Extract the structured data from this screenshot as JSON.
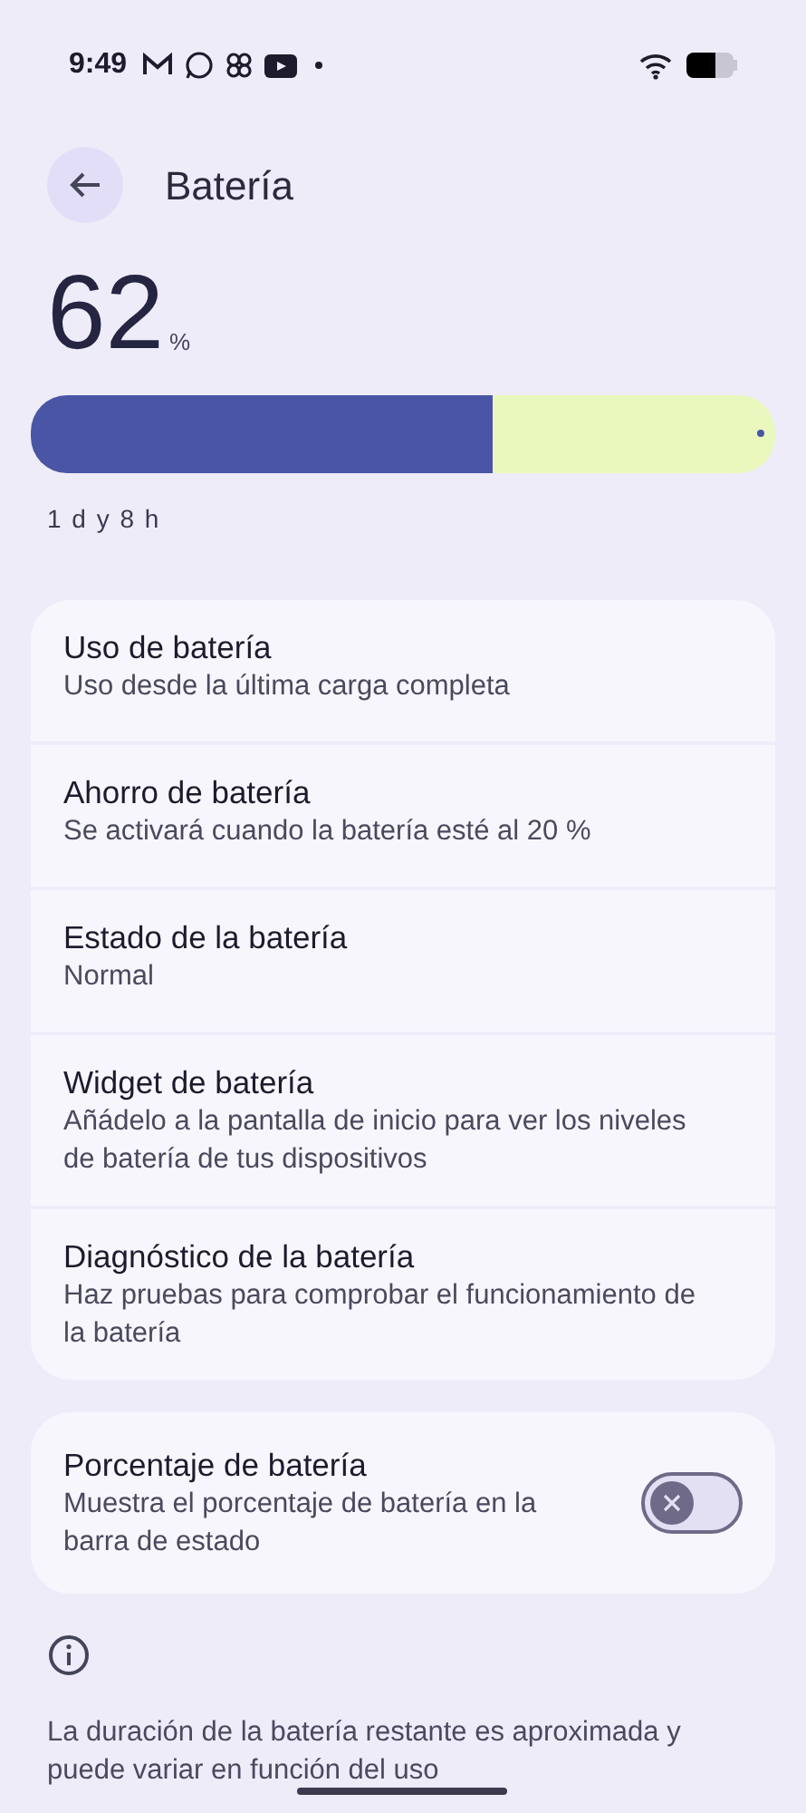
{
  "status_bar": {
    "time": "9:49"
  },
  "header": {
    "title": "Batería"
  },
  "battery": {
    "percent": "62",
    "unit": "%",
    "level": 0.62,
    "remaining": "1 d y 8 h"
  },
  "items": [
    {
      "title": "Uso de batería",
      "subtitle": "Uso desde la última carga completa"
    },
    {
      "title": "Ahorro de batería",
      "subtitle": "Se activará cuando la batería esté al 20 %"
    },
    {
      "title": "Estado de la batería",
      "subtitle": "Normal"
    },
    {
      "title": "Widget de batería",
      "subtitle": "Añádelo a la pantalla de inicio para ver los niveles de batería de tus dispositivos"
    },
    {
      "title": "Diagnóstico de la batería",
      "subtitle": "Haz pruebas para comprobar el funcionamiento de la batería"
    }
  ],
  "percentage_setting": {
    "title": "Porcentaje de batería",
    "subtitle": "Muestra el porcentaje de batería en la barra de estado",
    "on": false
  },
  "footer": {
    "text": "La duración de la batería restante es aproximada y puede variar en función del uso"
  }
}
